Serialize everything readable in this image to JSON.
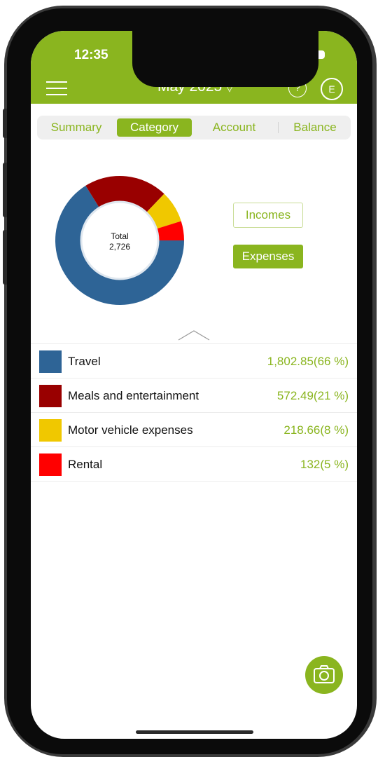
{
  "status": {
    "time": "12:35"
  },
  "header": {
    "title": "May 2025",
    "caret": "▽",
    "help": "?",
    "avatar": "E"
  },
  "tabs": [
    {
      "label": "Summary",
      "active": false
    },
    {
      "label": "Category",
      "active": true
    },
    {
      "label": "Account",
      "active": false
    },
    {
      "label": "Balance",
      "active": false
    }
  ],
  "chart_data": {
    "type": "pie",
    "center_label": "Total",
    "center_value": "2,726",
    "slices": [
      {
        "label": "Travel",
        "value": 1802.85,
        "percent": 66,
        "color": "#2e6496"
      },
      {
        "label": "Meals and entertainment",
        "value": 572.49,
        "percent": 21,
        "color": "#990000"
      },
      {
        "label": "Motor vehicle expenses",
        "value": 218.66,
        "percent": 8,
        "color": "#f0c800"
      },
      {
        "label": "Rental",
        "value": 132,
        "percent": 5,
        "color": "#ff0000"
      }
    ]
  },
  "toggle": {
    "incomes": "Incomes",
    "expenses": "Expenses"
  },
  "list": [
    {
      "label": "Travel",
      "value": "1,802.85(66 %)",
      "color": "#2e6496"
    },
    {
      "label": "Meals and entertainment",
      "value": "572.49(21 %)",
      "color": "#990000"
    },
    {
      "label": "Motor vehicle expenses",
      "value": "218.66(8 %)",
      "color": "#f0c800"
    },
    {
      "label": "Rental",
      "value": "132(5 %)",
      "color": "#ff0000"
    }
  ],
  "colors": {
    "accent": "#8ab51f"
  }
}
